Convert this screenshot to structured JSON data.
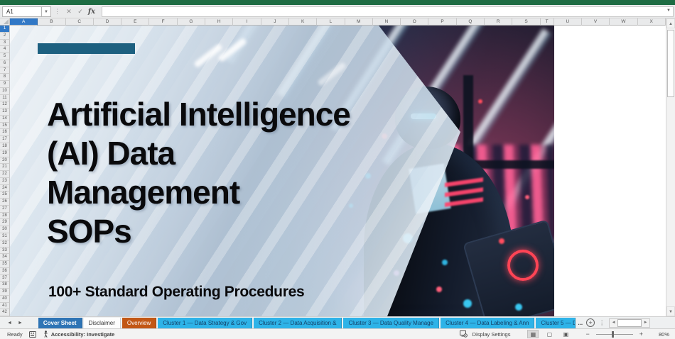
{
  "formula_bar": {
    "cell_reference": "A1",
    "fx_label": "fx",
    "cancel_glyph": "✕",
    "enter_glyph": "✓"
  },
  "grid": {
    "columns": [
      "A",
      "B",
      "C",
      "D",
      "E",
      "F",
      "G",
      "H",
      "I",
      "J",
      "K",
      "L",
      "M",
      "N",
      "O",
      "P",
      "Q",
      "R",
      "S",
      "T",
      "U",
      "V",
      "W",
      "X"
    ],
    "narrow_column": "T",
    "selected_column": "A",
    "row_count": 42,
    "selected_row": 1
  },
  "cover": {
    "title_lines": [
      "Artificial Intelligence",
      "(AI) Data",
      "Management",
      "SOPs"
    ],
    "subtitle": "100+ Standard Operating Procedures"
  },
  "sheet_tabs": {
    "nav_left": "◄",
    "nav_right": "►",
    "tabs": [
      {
        "label": "Cover Sheet",
        "bg": "#2e74b5",
        "fg": "#ffffff",
        "active": true,
        "truncated": false
      },
      {
        "label": "Disclaimer",
        "bg": "#fdfdfd",
        "fg": "#333333",
        "active": false,
        "truncated": false
      },
      {
        "label": "Overview",
        "bg": "#c25715",
        "fg": "#ffffff",
        "active": false,
        "truncated": false
      },
      {
        "label": "Cluster 1 — Data Strategy & Gov",
        "bg": "#2eb3e8",
        "fg": "#143f66",
        "active": false,
        "truncated": false
      },
      {
        "label": "Cluster 2 — Data Acquisition &",
        "bg": "#2eb3e8",
        "fg": "#143f66",
        "active": false,
        "truncated": false
      },
      {
        "label": "Cluster 3 — Data Quality Manage",
        "bg": "#2eb3e8",
        "fg": "#143f66",
        "active": false,
        "truncated": false
      },
      {
        "label": "Cluster 4 — Data Labeling & Ann",
        "bg": "#2eb3e8",
        "fg": "#143f66",
        "active": false,
        "truncated": false
      },
      {
        "label": "Cluster 5 — D",
        "bg": "#2eb3e8",
        "fg": "#143f66",
        "active": false,
        "truncated": true
      }
    ],
    "overflow_indicator": "...",
    "new_sheet_glyph": "+"
  },
  "status_bar": {
    "ready": "Ready",
    "accessibility": "Accessibility: Investigate",
    "display_settings": "Display Settings",
    "zoom_level": "80%",
    "zoom_out": "−",
    "zoom_in": "+"
  },
  "colors": {
    "excel_green": "#1e6c43",
    "selection_blue": "#3178c6",
    "cover_accent_bar": "#1d6080",
    "cluster_tab_blue": "#2eb3e8",
    "active_tab_blue": "#2e74b5",
    "overview_tab_orange": "#c25715"
  }
}
